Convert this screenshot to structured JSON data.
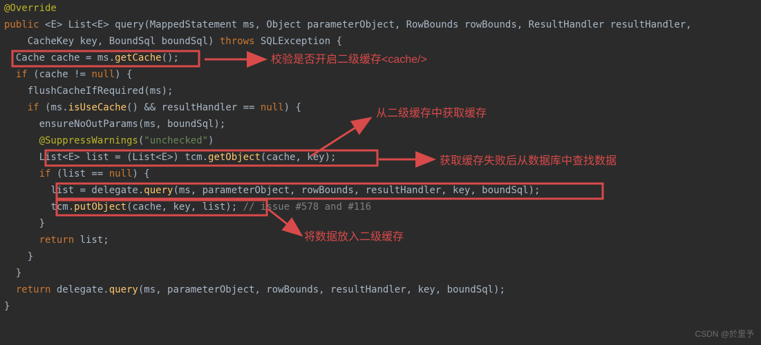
{
  "code": {
    "l01a": "@Override",
    "l02a": "public ",
    "l02b": "<E> List<E> query",
    "l02c": "(MappedStatement ms, Object parameterObject, RowBounds rowBounds, ResultHandler resultHandler,",
    "l03a": "    CacheKey key, BoundSql boundSql) ",
    "l03b": "throws ",
    "l03c": "SQLException {",
    "l04a": "  Cache cache = ms.",
    "l04b": "getCache",
    "l04c": "();",
    "l05a": "  if ",
    "l05b": "(cache != ",
    "l05c": "null",
    "l05d": ") {",
    "l06a": "    flushCacheIfRequired(ms);",
    "l07a": "    if ",
    "l07b": "(ms.",
    "l07c": "isUseCache",
    "l07d": "() && resultHandler == ",
    "l07e": "null",
    "l07f": ") {",
    "l08a": "      ensureNoOutParams(ms, boundSql);",
    "l09a": "      @SuppressWarnings",
    "l09b": "(",
    "l09c": "\"unchecked\"",
    "l09d": ")",
    "l10a": "      List<E> list = (List<E>) tcm.",
    "l10b": "getObject",
    "l10c": "(cache, key);",
    "l11a": "      if ",
    "l11b": "(list == ",
    "l11c": "null",
    "l11d": ") {",
    "l12a": "        list = delegate.",
    "l12b": "query",
    "l12c": "(ms, parameterObject, rowBounds, resultHandler, key, boundSql);",
    "l13a": "        tcm.",
    "l13b": "putObject",
    "l13c": "(cache, key, list);",
    "l13d": " // issue #578 and #116",
    "l14a": "      }",
    "l15a": "      return ",
    "l15b": "list;",
    "l16a": "    }",
    "l17a": "  }",
    "l18a": "  return ",
    "l18b": "delegate.",
    "l18c": "query",
    "l18d": "(ms, parameterObject, rowBounds, resultHandler, key, boundSql);",
    "l19a": "}"
  },
  "annotations": {
    "a1": "校验是否开启二级缓存<cache/>",
    "a2": "从二级缓存中获取缓存",
    "a3": "获取缓存失败后从数据库中查找数据",
    "a4": "将数据放入二级缓存"
  },
  "watermark": "CSDN @於里予"
}
